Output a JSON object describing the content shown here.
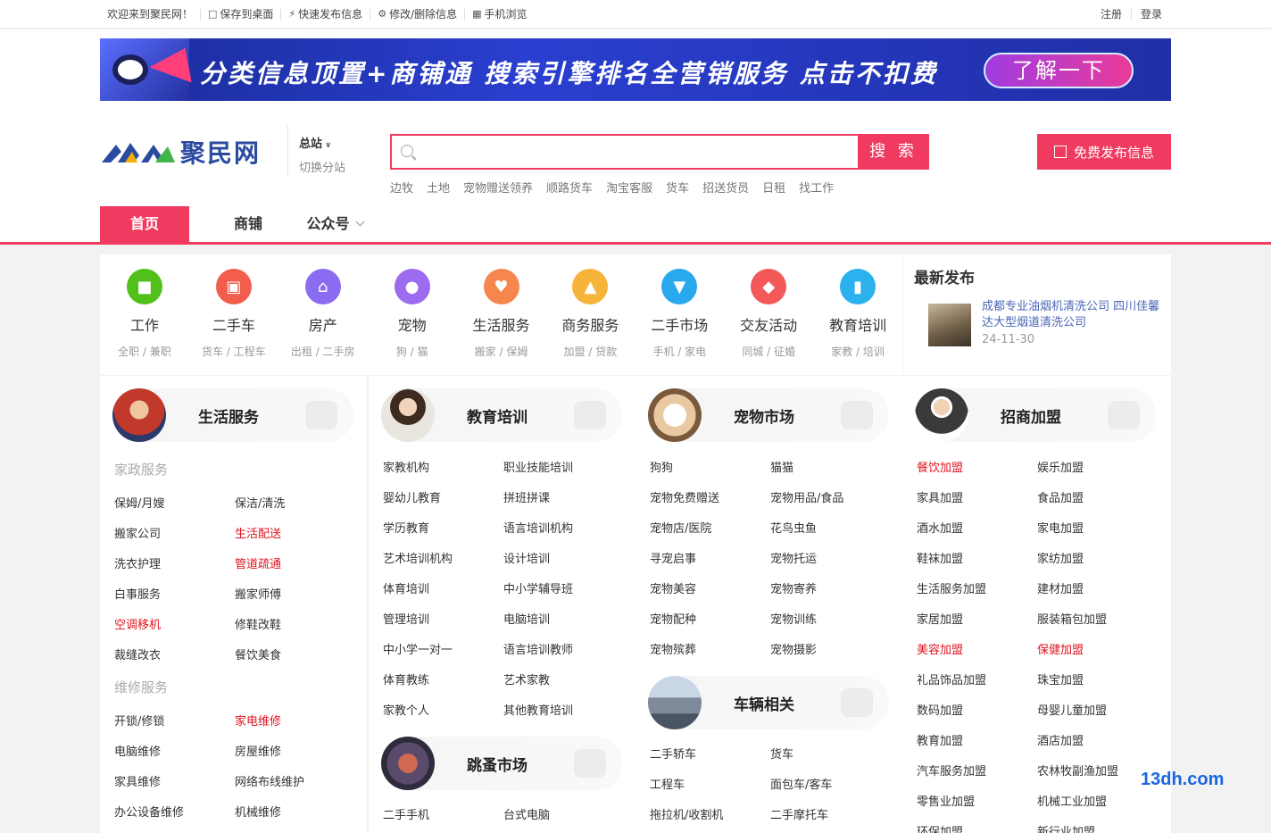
{
  "topbar": {
    "welcome": "欢迎来到聚民网！",
    "links": [
      {
        "icon": "monitor-icon",
        "label": "保存到桌面"
      },
      {
        "icon": "lightning-icon",
        "label": "快速发布信息"
      },
      {
        "icon": "gear-icon",
        "label": "修改/删除信息"
      },
      {
        "icon": "qrcode-icon",
        "label": "手机浏览"
      }
    ],
    "register": "注册",
    "login": "登录"
  },
  "banner": {
    "text": "分类信息顶置+商铺通 搜索引擎排名全营销服务 点击不扣费",
    "button": "了解一下"
  },
  "logo": {
    "text": "聚民网"
  },
  "station": {
    "current": "总站",
    "switch": "切换分站"
  },
  "search": {
    "placeholder": "",
    "button": "搜 索",
    "hotwords": [
      "边牧",
      "土地",
      "宠物赠送领养",
      "顺路货车",
      "淘宝客服",
      "货车",
      "招送货员",
      "日租",
      "找工作"
    ]
  },
  "post_button": "免费发布信息",
  "nav": {
    "home": "首页",
    "shops": "商铺",
    "wechat": "公众号"
  },
  "categories": [
    {
      "name": "工作",
      "sub": "全职 / 兼职",
      "color": "#52c01a",
      "icon": "briefcase-icon"
    },
    {
      "name": "二手车",
      "sub": "货车 / 工程车",
      "color": "#f25d4d",
      "icon": "car-icon"
    },
    {
      "name": "房产",
      "sub": "出租 / 二手房",
      "color": "#8a6cf0",
      "icon": "house-icon"
    },
    {
      "name": "宠物",
      "sub": "狗 / 猫",
      "color": "#9b6cf0",
      "icon": "dog-icon"
    },
    {
      "name": "生活服务",
      "sub": "搬家 / 保姆",
      "color": "#f6864e",
      "icon": "heart-hand-icon"
    },
    {
      "name": "商务服务",
      "sub": "加盟 / 贷款",
      "color": "#f7b43a",
      "icon": "shop-icon"
    },
    {
      "name": "二手市场",
      "sub": "手机 / 家电",
      "color": "#2aa8ee",
      "icon": "cart-icon"
    },
    {
      "name": "交友活动",
      "sub": "同城 / 征婚",
      "color": "#f4595a",
      "icon": "handshake-icon"
    },
    {
      "name": "教育培训",
      "sub": "家教 / 培训",
      "color": "#2bb1ee",
      "icon": "book-icon"
    }
  ],
  "latest": {
    "title": "最新发布",
    "item_title": "成都专业油烟机清洗公司 四川佳馨达大型烟道清洗公司",
    "item_date": "24-11-30"
  },
  "panels": {
    "life": {
      "title": "生活服务",
      "sec1": "家政服务",
      "sec2": "维修服务",
      "items1": [
        "保姆/月嫂",
        "保洁/清洗",
        "搬家公司",
        "生活配送",
        "洗衣护理",
        "管道疏通",
        "白事服务",
        "搬家师傅",
        "空调移机",
        "修鞋改鞋",
        "裁缝改衣",
        "餐饮美食"
      ],
      "items2": [
        "开锁/修锁",
        "家电维修",
        "电脑维修",
        "房屋维修",
        "家具维修",
        "网络布线维护",
        "办公设备维修",
        "机械维修"
      ]
    },
    "edu": {
      "title": "教育培训",
      "items": [
        "家教机构",
        "职业技能培训",
        "婴幼儿教育",
        "拼班拼课",
        "学历教育",
        "语言培训机构",
        "艺术培训机构",
        "设计培训",
        "体育培训",
        "中小学辅导班",
        "管理培训",
        "电脑培训",
        "中小学一对一",
        "语言培训教师",
        "体育教练",
        "艺术家教",
        "家教个人",
        "其他教育培训"
      ],
      "flea_title": "跳蚤市场",
      "flea_items": [
        "二手手机",
        "台式电脑"
      ]
    },
    "pet": {
      "title": "宠物市场",
      "items": [
        "狗狗",
        "猫猫",
        "宠物免费赠送",
        "宠物用品/食品",
        "宠物店/医院",
        "花鸟虫鱼",
        "寻宠启事",
        "宠物托运",
        "宠物美容",
        "宠物寄养",
        "宠物配种",
        "宠物训练",
        "宠物殡葬",
        "宠物摄影"
      ],
      "car_title": "车辆相关",
      "car_items": [
        "二手轿车",
        "货车",
        "工程车",
        "面包车/客车",
        "拖拉机/收割机",
        "二手摩托车"
      ]
    },
    "franchise": {
      "title": "招商加盟",
      "items": [
        "餐饮加盟",
        "娱乐加盟",
        "家具加盟",
        "食品加盟",
        "酒水加盟",
        "家电加盟",
        "鞋袜加盟",
        "家纺加盟",
        "生活服务加盟",
        "建材加盟",
        "家居加盟",
        "服装箱包加盟",
        "美容加盟",
        "保健加盟",
        "礼品饰品加盟",
        "珠宝加盟",
        "数码加盟",
        "母婴儿童加盟",
        "教育加盟",
        "酒店加盟",
        "汽车服务加盟",
        "农林牧副渔加盟",
        "零售业加盟",
        "机械工业加盟",
        "环保加盟",
        "新行业加盟"
      ]
    }
  },
  "red_items": [
    "生活配送",
    "管道疏通",
    "空调移机",
    "家电维修",
    "餐饮加盟",
    "美容加盟",
    "保健加盟"
  ],
  "watermark": "13dh.com"
}
